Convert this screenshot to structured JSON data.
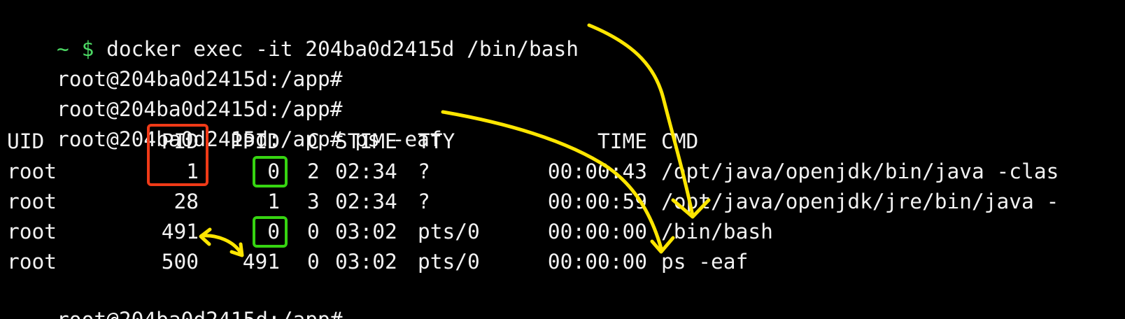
{
  "terminal": {
    "prompt_symbol_tilde": "~",
    "prompt_symbol_dollar": "$",
    "first_command": "docker exec -it 204ba0d2415d /bin/bash",
    "container_prompt": "root@204ba0d2415d:/app#",
    "ps_command": "ps -eaf",
    "columns": [
      "UID",
      "PID",
      "PPID",
      "C",
      "STIME",
      "TTY",
      "TIME",
      "CMD"
    ],
    "rows": [
      {
        "uid": "root",
        "pid": "1",
        "ppid": "0",
        "c": "2",
        "stime": "02:34",
        "tty": "?",
        "time": "00:00:43",
        "cmd": "/opt/java/openjdk/bin/java -clas"
      },
      {
        "uid": "root",
        "pid": "28",
        "ppid": "1",
        "c": "3",
        "stime": "02:34",
        "tty": "?",
        "time": "00:00:59",
        "cmd": "/opt/java/openjdk/jre/bin/java -"
      },
      {
        "uid": "root",
        "pid": "491",
        "ppid": "0",
        "c": "0",
        "stime": "03:02",
        "tty": "pts/0",
        "time": "00:00:00",
        "cmd": "/bin/bash"
      },
      {
        "uid": "root",
        "pid": "500",
        "ppid": "491",
        "c": "0",
        "stime": "03:02",
        "tty": "pts/0",
        "time": "00:00:00",
        "cmd": "ps -eaf"
      }
    ]
  },
  "annotations": {
    "red_box_color": "#f03a17",
    "green_box_color": "#36d411",
    "arrow_color": "#ffe600"
  }
}
